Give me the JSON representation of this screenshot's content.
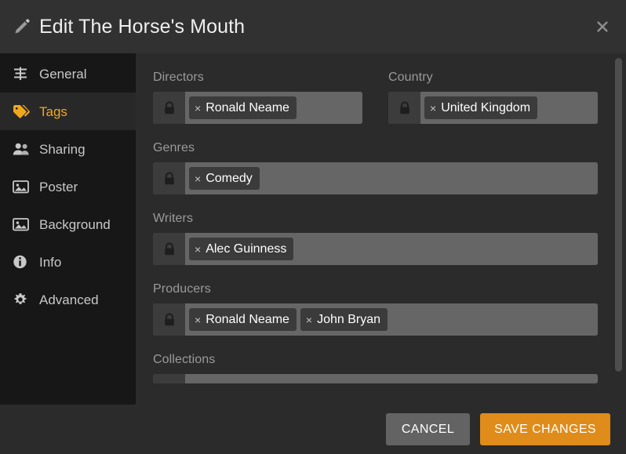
{
  "header": {
    "title": "Edit The Horse's Mouth",
    "icon": "pencil-icon",
    "close_label": "✕"
  },
  "sidebar": {
    "items": [
      {
        "label": "General",
        "icon": "list-icon",
        "active": false
      },
      {
        "label": "Tags",
        "icon": "tag-icon",
        "active": true
      },
      {
        "label": "Sharing",
        "icon": "people-icon",
        "active": false
      },
      {
        "label": "Poster",
        "icon": "image-icon",
        "active": false
      },
      {
        "label": "Background",
        "icon": "image-icon",
        "active": false
      },
      {
        "label": "Info",
        "icon": "info-circle-icon",
        "active": false
      },
      {
        "label": "Advanced",
        "icon": "gear-icon",
        "active": false
      }
    ]
  },
  "form": {
    "fields": [
      {
        "label": "Directors",
        "lock_icon": "lock-icon",
        "chips": [
          "Ronald Neame"
        ]
      },
      {
        "label": "Country",
        "lock_icon": "lock-icon",
        "chips": [
          "United Kingdom"
        ]
      },
      {
        "label": "Genres",
        "lock_icon": "lock-icon",
        "chips": [
          "Comedy"
        ]
      },
      {
        "label": "Writers",
        "lock_icon": "lock-icon",
        "chips": [
          "Alec Guinness"
        ]
      },
      {
        "label": "Producers",
        "lock_icon": "lock-icon",
        "chips": [
          "Ronald Neame",
          "John Bryan"
        ]
      },
      {
        "label": "Collections",
        "lock_icon": "lock-icon",
        "chips": []
      }
    ],
    "chip_remove_glyph": "×"
  },
  "footer": {
    "cancel_label": "CANCEL",
    "save_label": "SAVE CHANGES"
  },
  "colors": {
    "accent": "#f0a81e",
    "save_button": "#df8c1a",
    "cancel_button": "#636363",
    "sidebar_bg": "#171717",
    "content_bg": "#2b2b2b",
    "header_bg": "#313131",
    "input_bg": "#666666",
    "chip_bg": "#3b3b3b"
  }
}
